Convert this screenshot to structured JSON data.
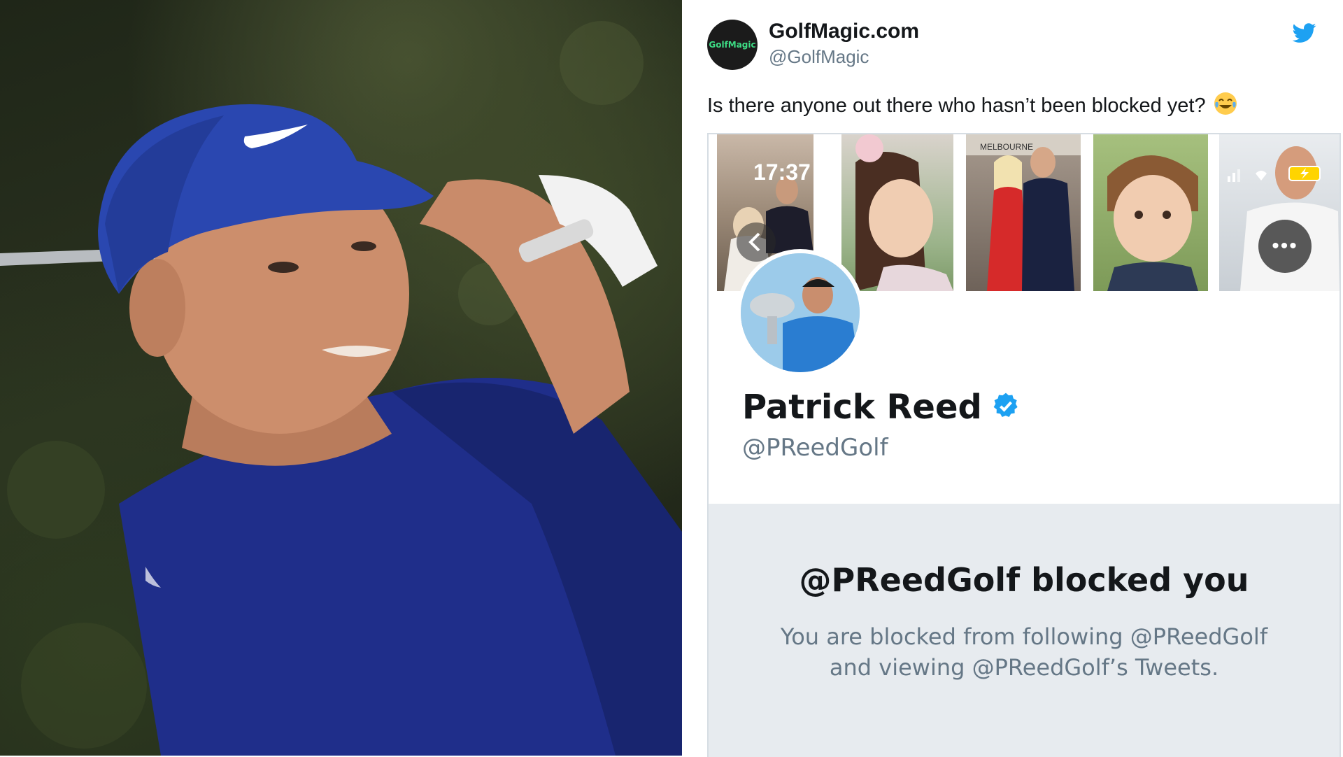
{
  "tweet": {
    "author_name": "GolfMagic.com",
    "author_handle": "@GolfMagic",
    "avatar_text": "GolfMagic",
    "text": "Is there anyone out there who hasn’t been blocked yet?",
    "emoji": "face-with-tears-of-joy"
  },
  "embedded_screenshot": {
    "status_time": "17:37",
    "thumb_4_sign": "MELBOURNE",
    "profile": {
      "name": "Patrick Reed",
      "handle": "@PReedGolf",
      "verified": true
    },
    "blocked": {
      "title": "@PReedGolf blocked you",
      "line1": "You are blocked from following @PReedGolf",
      "line2": "and viewing @PReedGolf’s Tweets."
    }
  },
  "colors": {
    "twitter_blue": "#1da1f2",
    "name_text": "#14171a",
    "secondary_text": "#657786",
    "blocked_bg": "#e7ebef"
  }
}
